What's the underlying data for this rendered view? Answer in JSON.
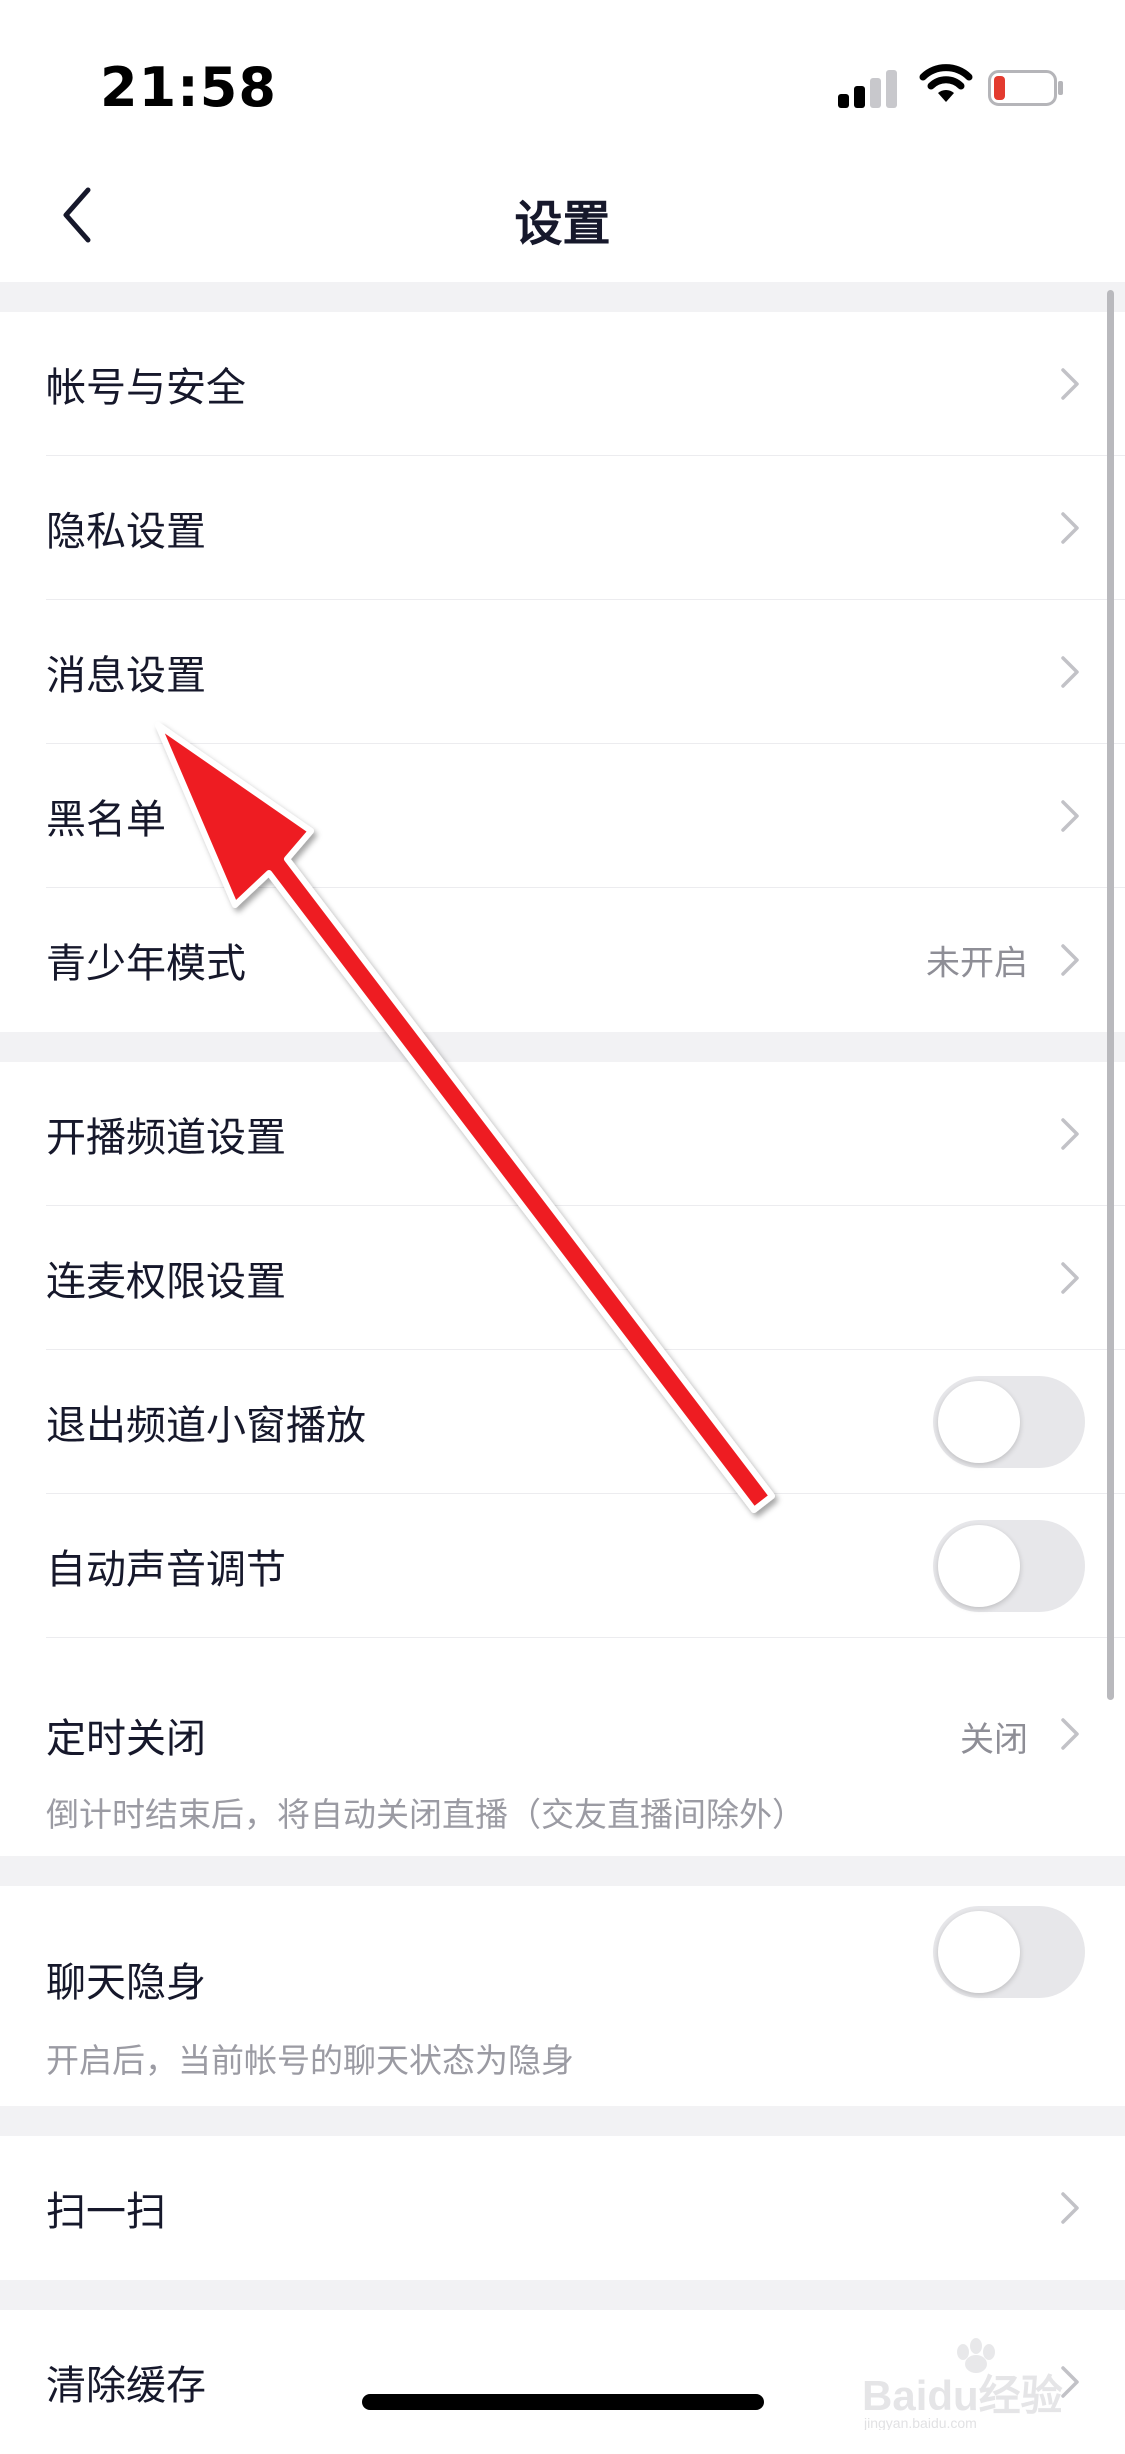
{
  "status_bar": {
    "time": "21:58",
    "icons": [
      "cellular-signal-icon",
      "wifi-icon",
      "battery-icon"
    ],
    "battery_color": "#e33b2f"
  },
  "navbar": {
    "title": "设置",
    "back_icon": "chevron-left-icon"
  },
  "groups": [
    {
      "items": [
        {
          "label": "帐号与安全",
          "control": "chevron"
        },
        {
          "label": "隐私设置",
          "control": "chevron"
        },
        {
          "label": "消息设置",
          "control": "chevron"
        },
        {
          "label": "黑名单",
          "control": "chevron"
        },
        {
          "label": "青少年模式",
          "value": "未开启",
          "control": "chevron"
        }
      ]
    },
    {
      "items": [
        {
          "label": "开播频道设置",
          "control": "chevron"
        },
        {
          "label": "连麦权限设置",
          "control": "chevron"
        },
        {
          "label": "退出频道小窗播放",
          "control": "toggle",
          "toggle_on": false
        },
        {
          "label": "自动声音调节",
          "control": "toggle",
          "toggle_on": false
        },
        {
          "label": "定时关闭",
          "value": "关闭",
          "control": "chevron",
          "description": "倒计时结束后，将自动关闭直播（交友直播间除外）"
        }
      ]
    },
    {
      "items": [
        {
          "label": "聊天隐身",
          "control": "toggle",
          "toggle_on": false,
          "description": "开启后，当前帐号的聊天状态为隐身"
        }
      ]
    },
    {
      "items": [
        {
          "label": "扫一扫",
          "control": "chevron"
        }
      ]
    },
    {
      "items": [
        {
          "label": "清除缓存",
          "control": "chevron"
        }
      ]
    }
  ],
  "annotation": {
    "icon": "red-arrow-annotation-icon",
    "color": "#ee1d23"
  },
  "watermark": {
    "text": "Baidu经验",
    "subtext": "jingyan.baidu.com",
    "icon": "baidu-paw-logo-icon"
  },
  "colors": {
    "background": "#f2f2f4",
    "text": "#16182b",
    "secondary_text": "#8e8e96",
    "toggle_off": "#e7e7ea"
  }
}
